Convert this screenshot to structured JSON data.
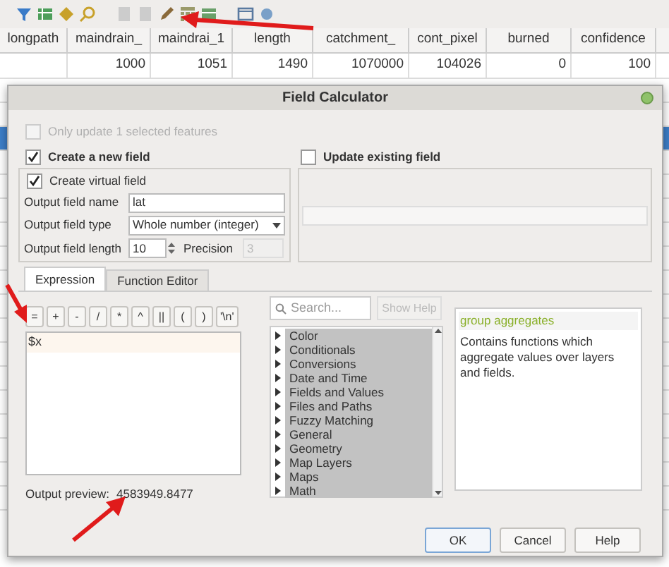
{
  "table": {
    "columns": [
      "longpath",
      "maindrain_",
      "maindrai_1",
      "length",
      "catchment_",
      "cont_pixel",
      "burned",
      "confidence"
    ],
    "rows": [
      {
        "cells": [
          null,
          "1000",
          "1051",
          "1490",
          "1070000",
          "104026",
          "0",
          "100"
        ]
      }
    ]
  },
  "dialog": {
    "title": "Field Calculator",
    "only_selected": {
      "label": "Only update 1 selected features",
      "checked": false,
      "disabled": true
    },
    "new_field": {
      "label": "Create a new field",
      "checked": true
    },
    "update_field": {
      "label": "Update existing field",
      "checked": false
    },
    "virtual_field": {
      "label": "Create virtual field",
      "checked": true
    },
    "name": {
      "label": "Output field name",
      "value": "lat"
    },
    "type": {
      "label": "Output field type",
      "value": "Whole number (integer)"
    },
    "length": {
      "label": "Output field length",
      "value": "10"
    },
    "precision": {
      "label": "Precision",
      "value": "3",
      "disabled": true
    },
    "tabs": [
      {
        "label": "Expression",
        "selected": true
      },
      {
        "label": "Function Editor",
        "selected": false
      }
    ],
    "operators": [
      "=",
      "+",
      "-",
      "/",
      "*",
      "^",
      "||",
      "(",
      ")",
      "'\\n'"
    ],
    "expression": "$x",
    "preview": {
      "label": "Output preview:",
      "value": "4583949.8477"
    },
    "search": {
      "placeholder": "Search..."
    },
    "show_help": {
      "label": "Show Help",
      "disabled": true
    },
    "groups": [
      "Color",
      "Conditionals",
      "Conversions",
      "Date and Time",
      "Fields and Values",
      "Files and Paths",
      "Fuzzy Matching",
      "General",
      "Geometry",
      "Map Layers",
      "Maps",
      "Math"
    ],
    "help": {
      "title": "group aggregates",
      "text": "Contains functions which aggregate values over layers and fields."
    },
    "buttons": [
      {
        "label": "OK",
        "default": true
      },
      {
        "label": "Cancel",
        "default": false
      },
      {
        "label": "Help",
        "default": false
      }
    ]
  }
}
